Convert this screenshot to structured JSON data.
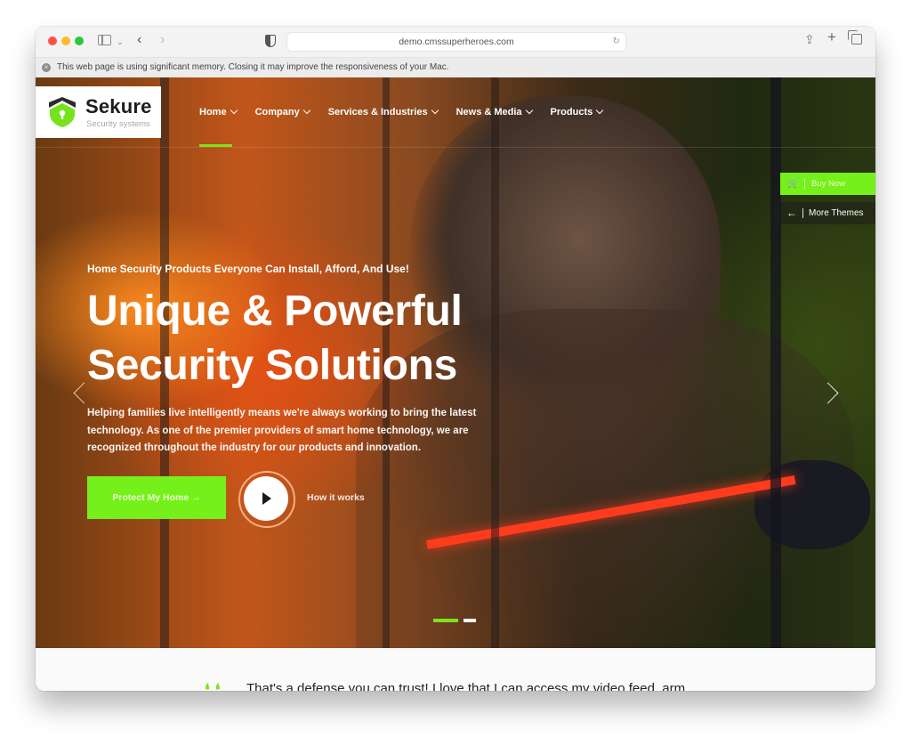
{
  "browser": {
    "url": "demo.cmssuperheroes.com",
    "memory_warning": "This web page is using significant memory. Closing it may improve the responsiveness of your Mac.",
    "icons": {
      "close": "close-circle-icon",
      "sidebar": "sidebar-icon",
      "back": "chevron-left-icon",
      "forward": "chevron-right-icon",
      "privacy": "shield-icon",
      "reload": "reload-icon",
      "share": "share-icon",
      "new_tab": "plus-icon",
      "tabs": "tabs-overview-icon"
    },
    "glyphs": {
      "back": "‹",
      "forward": "›",
      "reload": "↻",
      "share": "⇪",
      "plus": "+",
      "close": "×",
      "chevron": "⌄"
    }
  },
  "site": {
    "logo": {
      "name": "Sekure",
      "tagline": "Security systems"
    },
    "nav": [
      {
        "label": "Home",
        "active": true
      },
      {
        "label": "Company"
      },
      {
        "label": "Services & Industries"
      },
      {
        "label": "News & Media"
      },
      {
        "label": "Products"
      }
    ],
    "side_buttons": {
      "buy_now": "Buy Now",
      "buy_now_icon": "🛒",
      "more_themes": "More Themes",
      "more_themes_icon": "←"
    },
    "hero": {
      "eyebrow": "Home Security Products Everyone Can Install, Afford, And Use!",
      "headline_line1": "Unique & Powerful",
      "headline_line2": "Security Solutions",
      "description": "Helping families live intelligently means we're always working to bring the latest technology. As one of the premier providers of smart home technology, we are recognized throughout the industry for our products and innovation.",
      "cta_label": "Protect My Home →",
      "video_label": "How it works",
      "slides_total": 2,
      "active_slide": 1
    },
    "testimonial": {
      "quote_mark": "❛❛",
      "text": "That's a defense you can trust! I love that I can access my video feed, arm"
    },
    "colors": {
      "accent": "#76f01a",
      "text_light": "#ffffff"
    }
  }
}
